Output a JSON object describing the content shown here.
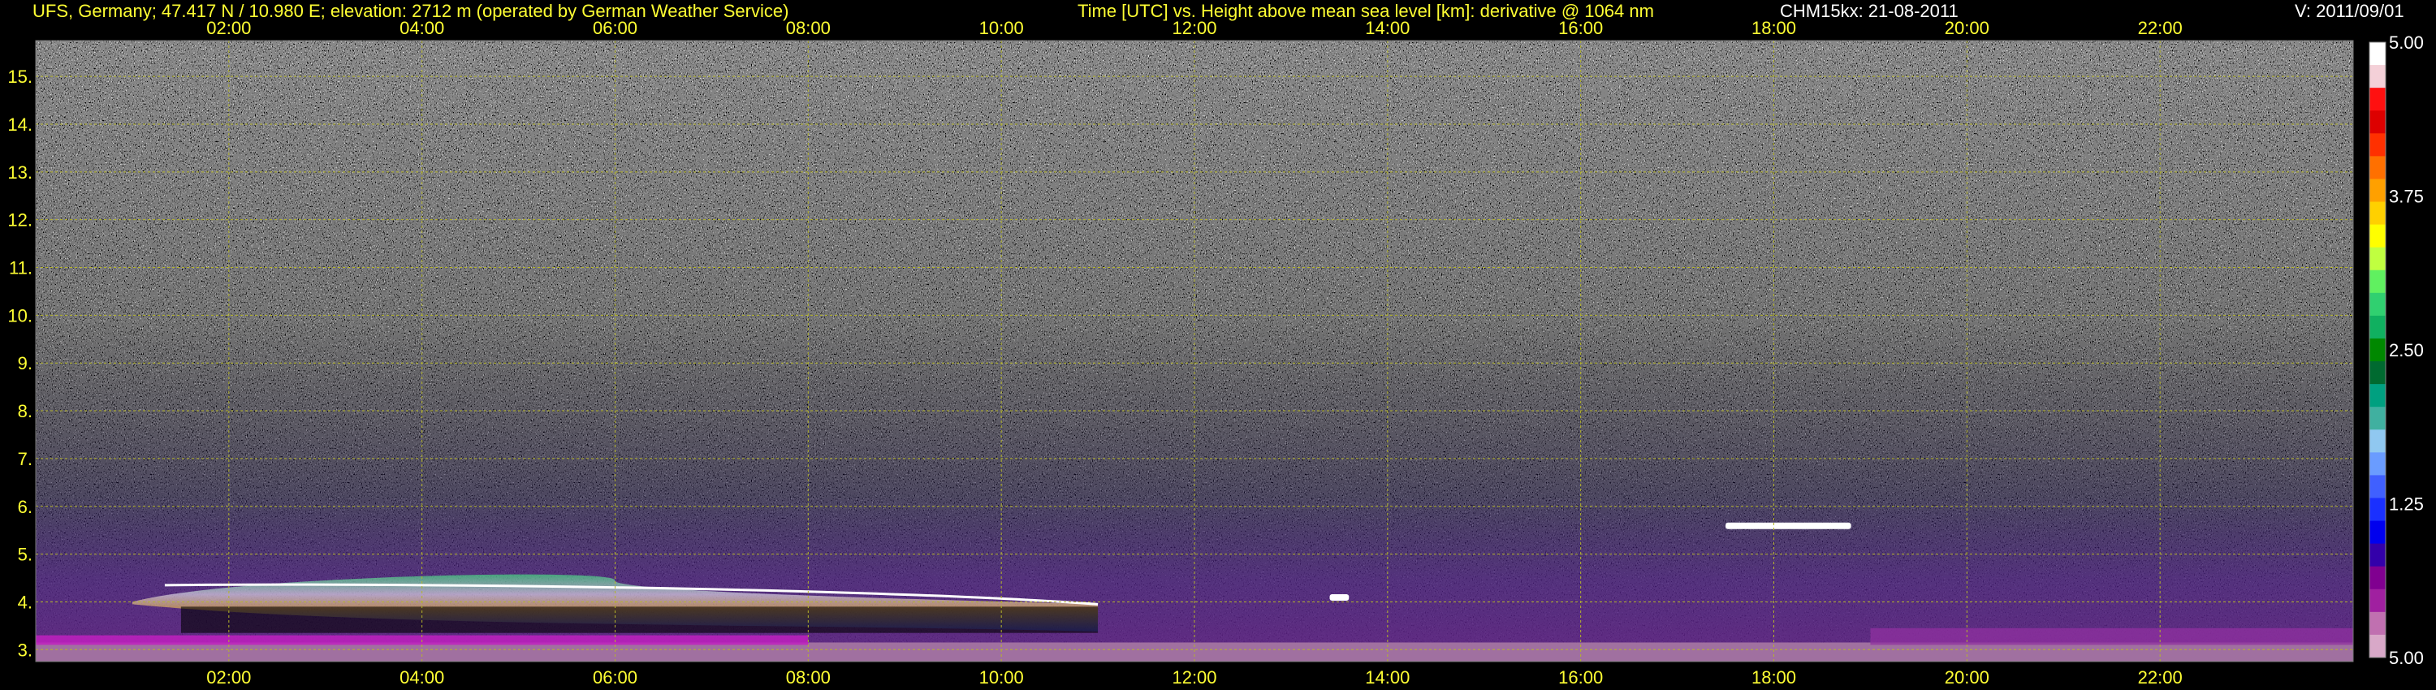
{
  "header": {
    "station": "UFS, Germany; 47.417 N / 10.980 E; elevation: 2712 m  (operated by German Weather Service)",
    "plot_title": "Time [UTC] vs. Height above mean sea level [km]: derivative @ 1064 nm",
    "instrument": "CHM15kx: 21-08-2011",
    "version": "V: 2011/09/01"
  },
  "colors": {
    "text_yellow": "#ffff33",
    "grid": "#b5b52a",
    "background": "#000000"
  },
  "chart_data": {
    "type": "heatmap",
    "title": "Time [UTC] vs. Height above mean sea level [km]: derivative @ 1064 nm",
    "x_ticks": [
      "02:00",
      "04:00",
      "06:00",
      "08:00",
      "10:00",
      "12:00",
      "14:00",
      "16:00",
      "18:00",
      "20:00",
      "22:00"
    ],
    "x_tick_hours": [
      2,
      4,
      6,
      8,
      10,
      12,
      14,
      16,
      18,
      20,
      22
    ],
    "xlim_hours": [
      0,
      24
    ],
    "y_ticks": [
      "3.",
      "4.",
      "5.",
      "6.",
      "7.",
      "8.",
      "9.",
      "10.",
      "11.",
      "12.",
      "13.",
      "14.",
      "15."
    ],
    "y_tick_values": [
      3,
      4,
      5,
      6,
      7,
      8,
      9,
      10,
      11,
      12,
      13,
      14,
      15
    ],
    "ylim_km": [
      2.75,
      15.75
    ],
    "grid": true,
    "colorbar": {
      "ticks": [
        "5.00",
        "3.75",
        "2.50",
        "1.25",
        "5.00"
      ],
      "colors": [
        "#ffffff",
        "#f4d0d8",
        "#ff1010",
        "#dd0000",
        "#ff3000",
        "#ff7000",
        "#ffa000",
        "#ffd000",
        "#ffff00",
        "#c0ff40",
        "#60f060",
        "#30d070",
        "#10b060",
        "#008800",
        "#006a30",
        "#00a080",
        "#40b0a0",
        "#90c8f0",
        "#6a9cff",
        "#4060ff",
        "#1a30ff",
        "#0000ee",
        "#3300aa",
        "#800090",
        "#a020a0",
        "#c070b0",
        "#d8a8c8"
      ]
    },
    "features": [
      {
        "name": "elevated aerosol layer",
        "x_start_h": 1.0,
        "x_end_h": 11.0,
        "height_km": 4.4
      },
      {
        "name": "cloud",
        "x_start_h": 17.5,
        "x_end_h": 18.8,
        "height_km": 5.6
      },
      {
        "name": "cloud",
        "x_start_h": 13.4,
        "x_end_h": 13.6,
        "height_km": 4.1
      }
    ]
  }
}
